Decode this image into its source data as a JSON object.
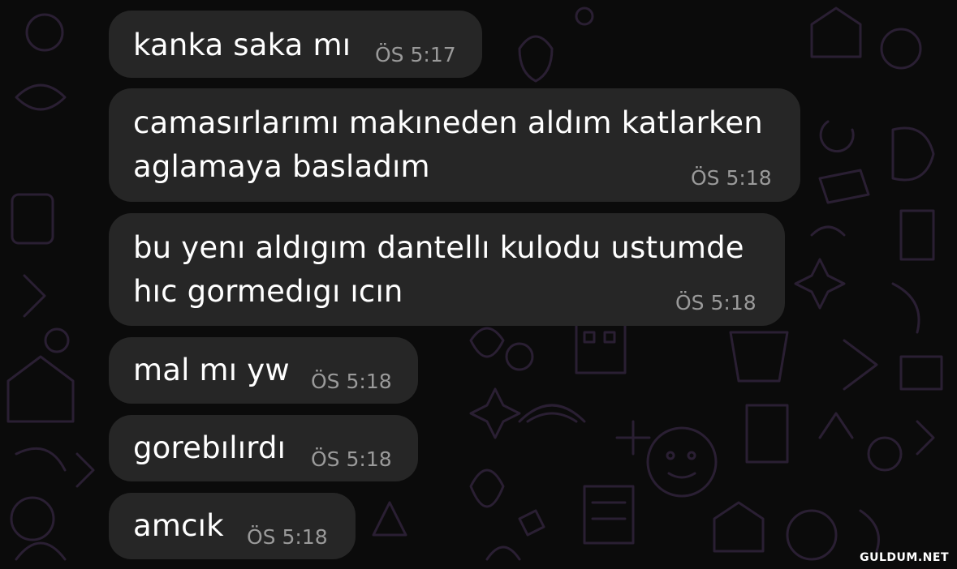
{
  "messages": [
    {
      "lines": [
        "kanka saka mı"
      ],
      "time": "ÖS 5:17"
    },
    {
      "lines": [
        "camasırlarımı makıneden aldım katlarken",
        "aglamaya basladım"
      ],
      "time": "ÖS 5:18"
    },
    {
      "lines": [
        "bu yenı aldıgım dantellı kulodu ustumde",
        "hıc gormedıgı ıcın"
      ],
      "time": "ÖS 5:18"
    },
    {
      "lines": [
        "mal mı yw"
      ],
      "time": "ÖS 5:18"
    },
    {
      "lines": [
        "gorebılırdı"
      ],
      "time": "ÖS 5:18"
    },
    {
      "lines": [
        "amcık"
      ],
      "time": "ÖS 5:18"
    }
  ],
  "watermark": "GULDUM.NET",
  "colors": {
    "background": "#0b0b0b",
    "bubble": "#262626",
    "text": "#ffffff",
    "timestamp": "#9a9a9a",
    "wallpaper_doodle": "#2a1f33"
  }
}
